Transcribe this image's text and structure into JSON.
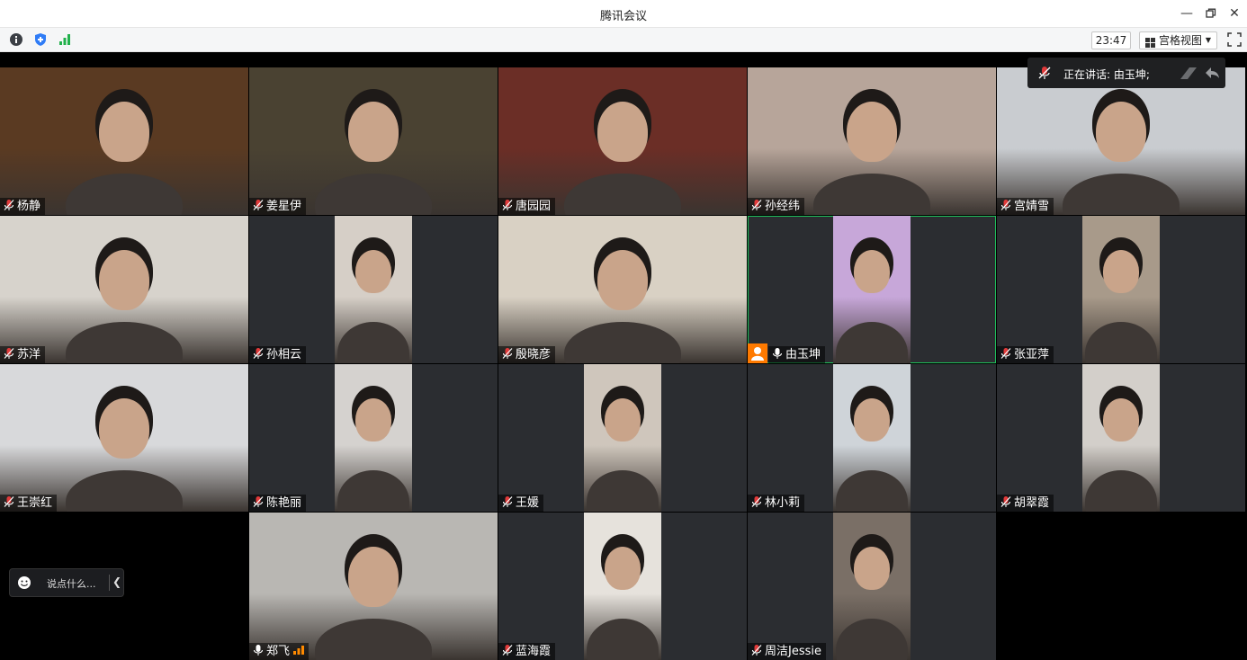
{
  "window": {
    "title": "腾讯会议",
    "controls": [
      "minimize-icon",
      "restore-icon",
      "close-icon"
    ]
  },
  "toolbar": {
    "icons": [
      "info-icon",
      "shield-icon",
      "signal-icon"
    ],
    "time": "23:47",
    "view_label": "宫格视图",
    "fullscreen_icon": "fullscreen-icon"
  },
  "speaking": {
    "text": "正在讲话: 由玉坤;"
  },
  "chat": {
    "placeholder": "说点什么..."
  },
  "participants": [
    {
      "name": "杨静",
      "bg": "#5a3a22",
      "muted": true
    },
    {
      "name": "姜星伊",
      "bg": "#4a4232",
      "muted": true
    },
    {
      "name": "唐园园",
      "bg": "#6b2e26",
      "muted": true
    },
    {
      "name": "孙经纬",
      "bg": "#b7a59a",
      "muted": true
    },
    {
      "name": "宫婧雪",
      "bg": "#c9ccd0",
      "muted": true
    },
    {
      "name": "苏洋",
      "bg": "#d7d3cc",
      "muted": true
    },
    {
      "name": "孙相云",
      "bg": "#d6cfc7",
      "muted": true
    },
    {
      "name": "殷晓彦",
      "bg": "#d9d1c4",
      "muted": true
    },
    {
      "name": "由玉坤",
      "bg": "#c7a7d9",
      "muted": false,
      "host": true,
      "active": true
    },
    {
      "name": "张亚萍",
      "bg": "#a89a8a",
      "muted": true
    },
    {
      "name": "王崇红",
      "bg": "#d8d9db",
      "muted": true
    },
    {
      "name": "陈艳丽",
      "bg": "#d5d2cf",
      "muted": true
    },
    {
      "name": "王媛",
      "bg": "#cfc6bc",
      "muted": true
    },
    {
      "name": "林小莉",
      "bg": "#cfd4d9",
      "muted": true
    },
    {
      "name": "胡翠霞",
      "bg": "#d3cfca",
      "muted": true
    },
    {
      "name": "郑飞",
      "bg": "#b9b7b3",
      "muted": false,
      "signal": true
    },
    {
      "name": "蓝海霞",
      "bg": "#e6e2dc",
      "muted": true
    },
    {
      "name": "周洁Jessie",
      "bg": "#7a6f66",
      "muted": true
    }
  ],
  "colors": {
    "accent_green": "#1fbf5a",
    "host_orange": "#ff7a00",
    "muted_red": "#e03a3a"
  }
}
